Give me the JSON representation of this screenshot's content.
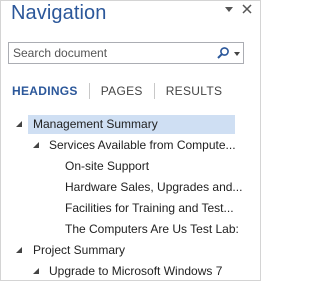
{
  "pane": {
    "title": "Navigation",
    "menu_icon": "chevron-down-icon",
    "close_icon": "close-icon"
  },
  "search": {
    "placeholder": "Search document",
    "value": "",
    "icon": "search-icon",
    "dropdown_icon": "chevron-down-icon"
  },
  "tabs": [
    {
      "label": "HEADINGS",
      "active": true
    },
    {
      "label": "PAGES",
      "active": false
    },
    {
      "label": "RESULTS",
      "active": false
    }
  ],
  "headings": [
    {
      "text": "Management Summary",
      "level": 1,
      "expanded": true,
      "selected": true
    },
    {
      "text": "Services Available from Compute...",
      "level": 2,
      "expanded": true,
      "selected": false
    },
    {
      "text": "On-site Support",
      "level": 3,
      "selected": false
    },
    {
      "text": "Hardware Sales, Upgrades and...",
      "level": 3,
      "selected": false
    },
    {
      "text": "Facilities for Training and Test...",
      "level": 3,
      "selected": false
    },
    {
      "text": "The Computers Are Us Test Lab:",
      "level": 3,
      "selected": false
    },
    {
      "text": "Project Summary",
      "level": 1,
      "expanded": true,
      "selected": false
    },
    {
      "text": "Upgrade to Microsoft Windows 7",
      "level": 2,
      "expanded": true,
      "selected": false
    }
  ],
  "colors": {
    "accent": "#2b579a",
    "selection": "#cfdff3",
    "border": "#abadb3"
  }
}
